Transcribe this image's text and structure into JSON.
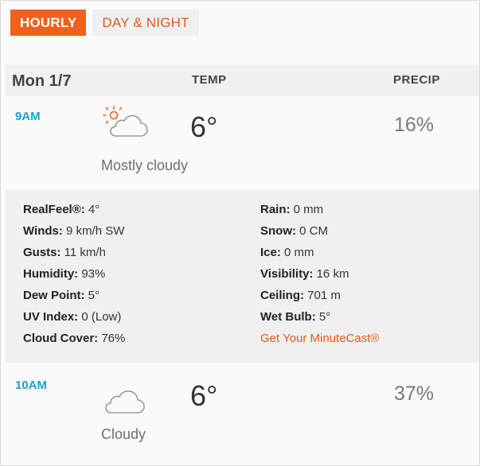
{
  "tabs": {
    "hourly": "HOURLY",
    "day_night": "DAY & NIGHT"
  },
  "header": {
    "date": "Mon 1/7",
    "temp_col": "TEMP",
    "precip_col": "PRECIP"
  },
  "hours": [
    {
      "time": "9AM",
      "icon": "partly-cloudy-sun-icon",
      "temp": "6°",
      "precip": "16%",
      "phrase": "Mostly cloudy"
    },
    {
      "time": "10AM",
      "icon": "cloud-icon",
      "temp": "6°",
      "precip": "37%",
      "phrase": "Cloudy"
    }
  ],
  "details": {
    "left": [
      {
        "label": "RealFeel®:",
        "value": " 4°"
      },
      {
        "label": "Winds:",
        "value": " 9 km/h SW"
      },
      {
        "label": "Gusts:",
        "value": " 11 km/h"
      },
      {
        "label": "Humidity:",
        "value": " 93%"
      },
      {
        "label": "Dew Point:",
        "value": " 5°"
      },
      {
        "label": "UV Index:",
        "value": " 0 (Low)"
      },
      {
        "label": "Cloud Cover:",
        "value": " 76%"
      }
    ],
    "right": [
      {
        "label": "Rain:",
        "value": " 0 mm"
      },
      {
        "label": "Snow:",
        "value": " 0 CM"
      },
      {
        "label": "Ice:",
        "value": " 0 mm"
      },
      {
        "label": "Visibility:",
        "value": " 16 km"
      },
      {
        "label": "Ceiling:",
        "value": " 701 m"
      },
      {
        "label": "Wet Bulb:",
        "value": " 5°"
      }
    ],
    "minutecast_link": "Get Your MinuteCast®"
  },
  "colors": {
    "accent": "#f0611e",
    "time": "#1aa3c9",
    "link": "#e4571b"
  }
}
